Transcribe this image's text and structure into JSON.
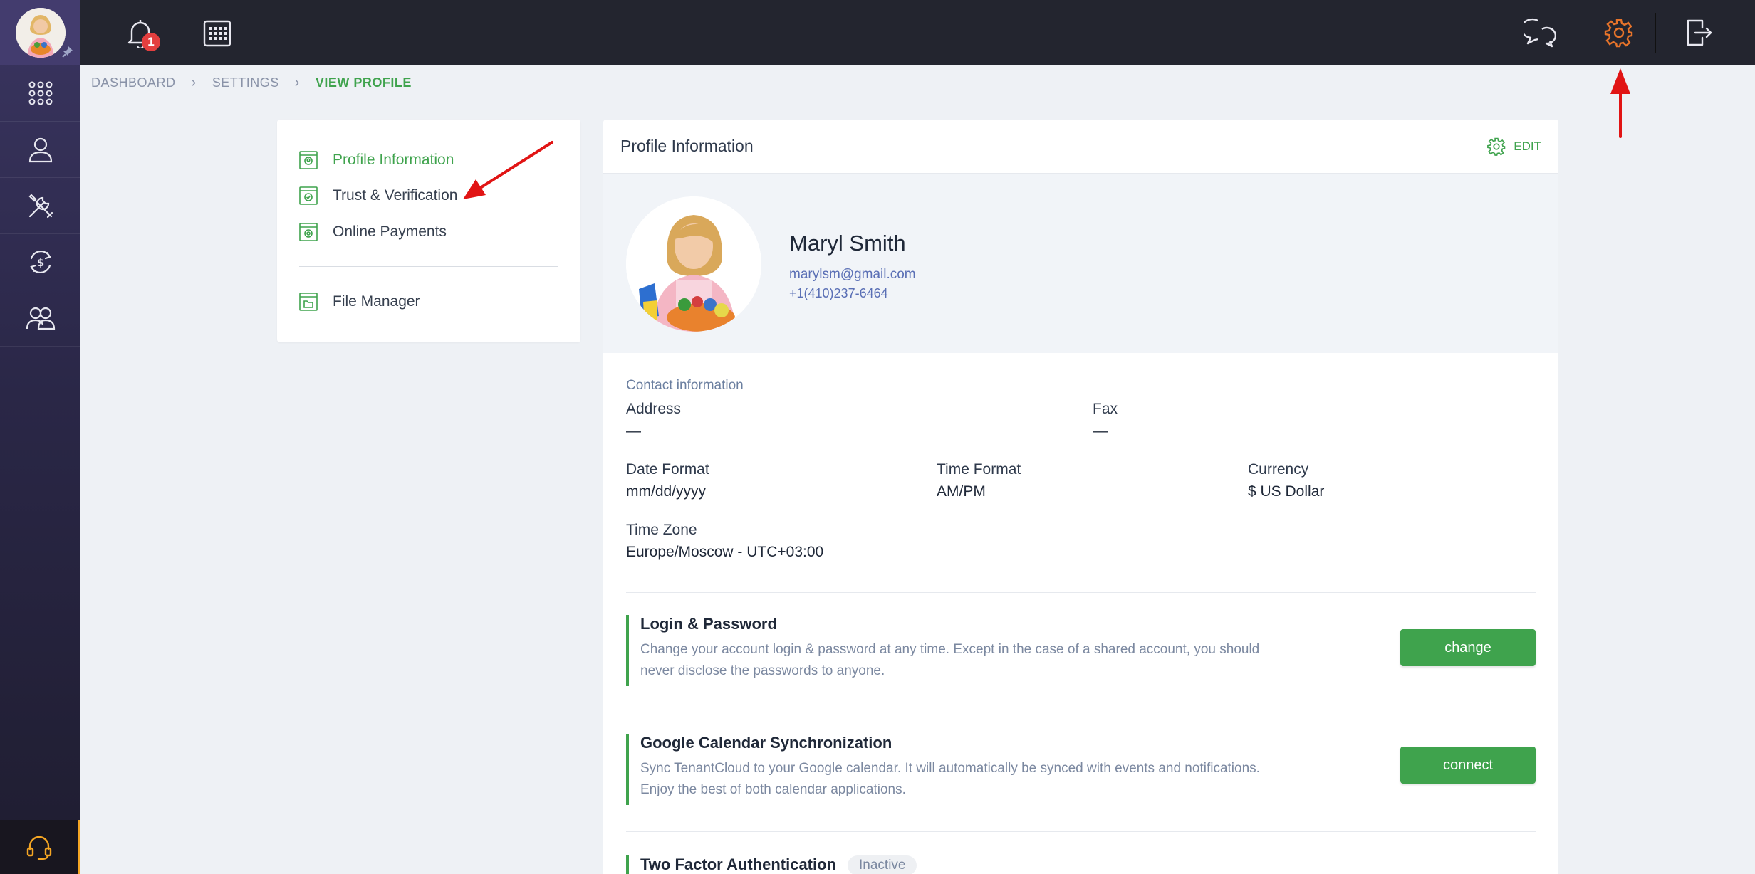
{
  "notifications": {
    "badge_count": "1"
  },
  "breadcrumb": {
    "items": [
      "DASHBOARD",
      "SETTINGS",
      "VIEW PROFILE"
    ]
  },
  "menu": {
    "items": [
      {
        "label": "Profile Information",
        "active": true
      },
      {
        "label": "Trust & Verification",
        "active": false
      },
      {
        "label": "Online Payments",
        "active": false
      }
    ],
    "file_manager": "File Manager"
  },
  "profile": {
    "header_title": "Profile Information",
    "edit_label": "EDIT",
    "name": "Maryl Smith",
    "email": "marylsm@gmail.com",
    "phone": "+1(410)237-6464"
  },
  "contact": {
    "section_title": "Contact information",
    "address_label": "Address",
    "address_value": "—",
    "fax_label": "Fax",
    "fax_value": "—",
    "date_format_label": "Date Format",
    "date_format_value": "mm/dd/yyyy",
    "time_format_label": "Time Format",
    "time_format_value": "AM/PM",
    "currency_label": "Currency",
    "currency_value": "$ US Dollar",
    "timezone_label": "Time Zone",
    "timezone_value": "Europe/Moscow - UTC+03:00"
  },
  "features": {
    "login": {
      "title": "Login & Password",
      "description": "Change your account login & password at any time. Except in the case of a shared account, you should never disclose the passwords to anyone.",
      "button": "change"
    },
    "gcal": {
      "title": "Google Calendar Synchronization",
      "description": "Sync TenantCloud to your Google calendar. It will automatically be synced with events and notifications. Enjoy the best of both calendar applications.",
      "button": "connect"
    },
    "twofa": {
      "title": "Two Factor Authentication",
      "status": "Inactive"
    }
  },
  "colors": {
    "accent_green": "#3fa34d",
    "topbar": "#23252f",
    "sidebar": "#2a2747",
    "active_gear": "#e8742a",
    "annotation_arrow": "#e11414"
  }
}
